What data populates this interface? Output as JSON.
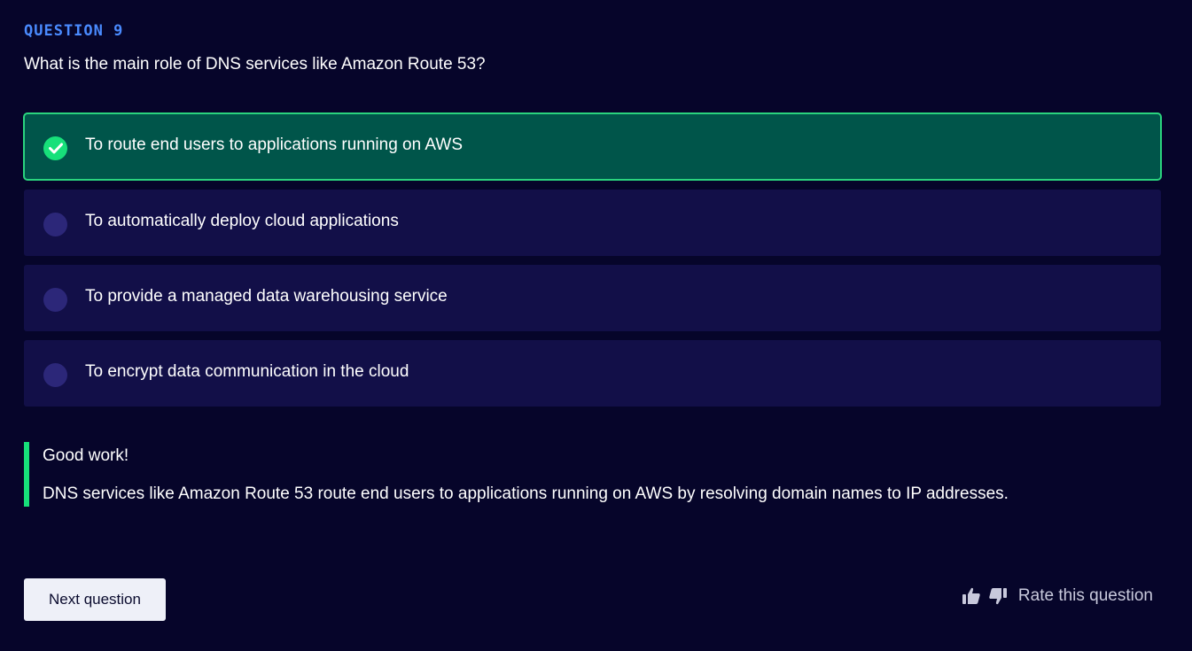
{
  "question": {
    "label": "QUESTION 9",
    "text": "What is the main role of DNS services like Amazon Route 53?"
  },
  "options": [
    {
      "label": "To route end users to applications running on AWS",
      "state": "correct"
    },
    {
      "label": "To automatically deploy cloud applications",
      "state": "unselected"
    },
    {
      "label": "To provide a managed data warehousing service",
      "state": "unselected"
    },
    {
      "label": "To encrypt data communication in the cloud",
      "state": "unselected"
    }
  ],
  "feedback": {
    "title": "Good work!",
    "body": "DNS services like Amazon Route 53 route end users to applications running on AWS by resolving domain names to IP addresses."
  },
  "actions": {
    "next_label": "Next question",
    "rate_label": "Rate this question"
  },
  "icons": {
    "check": "check-icon",
    "thumbs_up": "thumbs-up-icon",
    "thumbs_down": "thumbs-down-icon"
  },
  "colors": {
    "accent_blue": "#4a8bff",
    "correct_green": "#17e07a",
    "correct_bg": "#00554a",
    "option_bg": "#120f48",
    "page_bg": "#06052a"
  }
}
